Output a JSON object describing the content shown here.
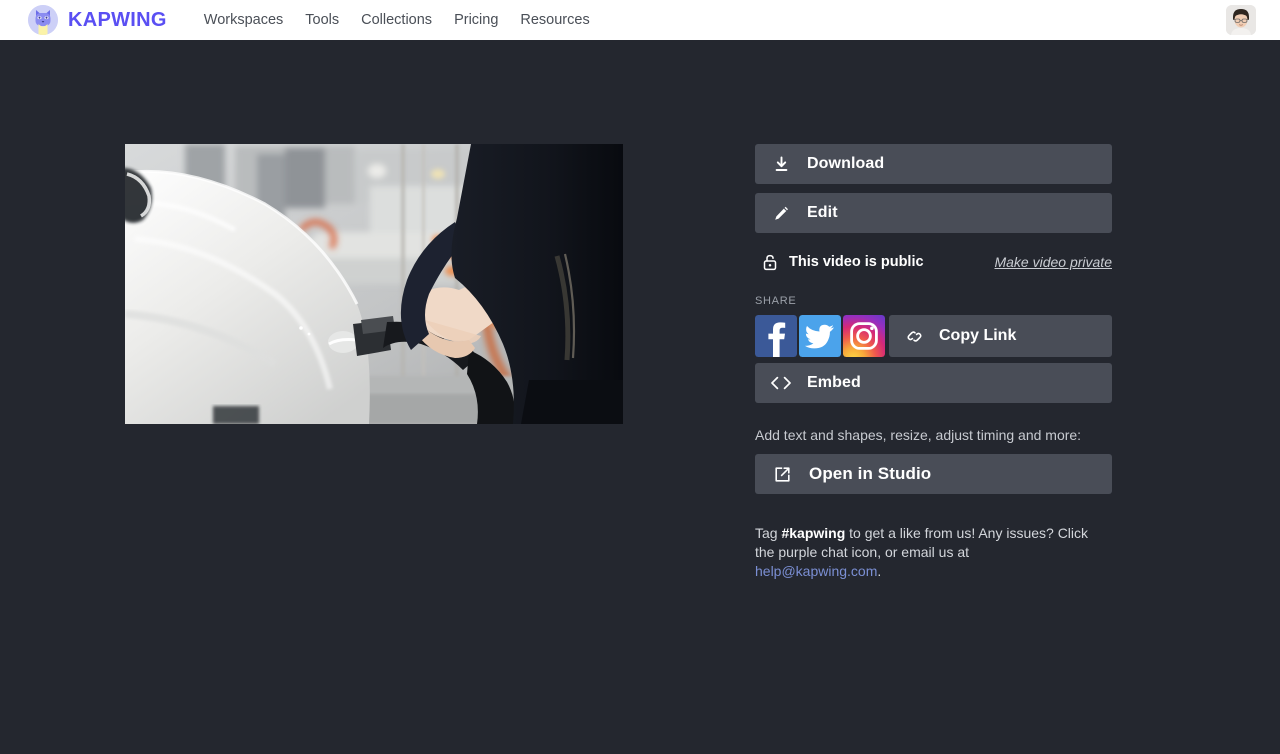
{
  "header": {
    "brand_name": "KAPWING",
    "brand_icon": "kapwing-cat-logo",
    "nav_items": [
      {
        "label": "Workspaces"
      },
      {
        "label": "Tools"
      },
      {
        "label": "Collections"
      },
      {
        "label": "Pricing"
      },
      {
        "label": "Resources"
      }
    ],
    "avatar_icon": "user-avatar"
  },
  "video": {
    "alt": "Person plugging an EV charging cable into a white car",
    "icon": "video-thumbnail"
  },
  "panel": {
    "download_label": "Download",
    "download_icon": "download-icon",
    "edit_label": "Edit",
    "edit_icon": "pencil-icon",
    "privacy_status": "This video is public",
    "privacy_icon": "unlocked-padlock-icon",
    "privacy_toggle_label": "Make video private",
    "share_label": "SHARE",
    "social": [
      {
        "name": "facebook",
        "icon": "facebook-icon",
        "color": "#3b5998"
      },
      {
        "name": "twitter",
        "icon": "twitter-icon",
        "color": "#4ba3eb"
      },
      {
        "name": "instagram",
        "icon": "instagram-icon",
        "color": "#d62976"
      }
    ],
    "copy_link_label": "Copy Link",
    "copy_link_icon": "chain-link-icon",
    "embed_label": "Embed",
    "embed_icon": "code-brackets-icon",
    "studio_note": "Add text and shapes, resize, adjust timing and more:",
    "studio_label": "Open in Studio",
    "studio_icon": "external-link-icon",
    "footer": {
      "part1": "Tag ",
      "hashtag": "#kapwing",
      "part2": " to get a like from us! Any issues? Click the purple chat icon, or email us at ",
      "email": "help@kapwing.com",
      "part3": "."
    }
  },
  "colors": {
    "page_background": "#24272f",
    "button_fill": "#494d57",
    "brand_purple": "#5a4ff3",
    "link_blue": "#7b8fd4",
    "topbar": "#ffffff"
  }
}
